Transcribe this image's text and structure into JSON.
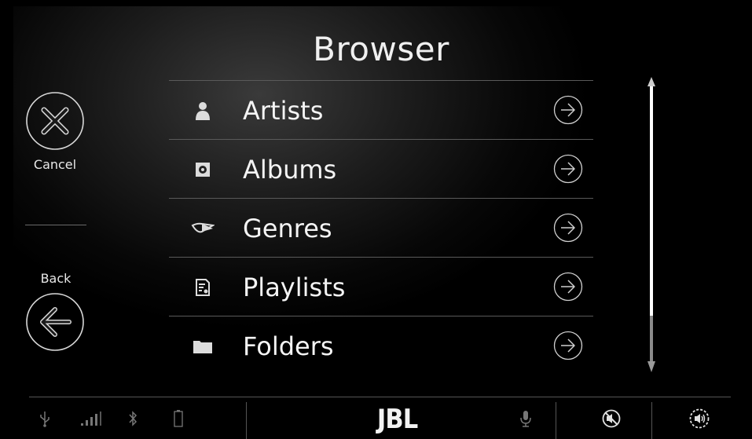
{
  "header": {
    "title": "Browser"
  },
  "sidebar": {
    "cancel_label": "Cancel",
    "back_label": "Back"
  },
  "list": {
    "items": [
      {
        "label": "Artists",
        "icon": "person-icon"
      },
      {
        "label": "Albums",
        "icon": "album-icon"
      },
      {
        "label": "Genres",
        "icon": "genre-horn-icon"
      },
      {
        "label": "Playlists",
        "icon": "playlist-icon"
      },
      {
        "label": "Folders",
        "icon": "folder-icon"
      }
    ]
  },
  "statusbar": {
    "brand": "JBL",
    "icons": [
      "usb-icon",
      "signal-icon",
      "bluetooth-icon",
      "battery-icon",
      "microphone-icon",
      "mute-icon",
      "volume-icon"
    ]
  },
  "scroll": {
    "position": 0.0
  },
  "colors": {
    "background": "#000000",
    "text": "#ffffff",
    "divider": "#5a5a5a"
  }
}
